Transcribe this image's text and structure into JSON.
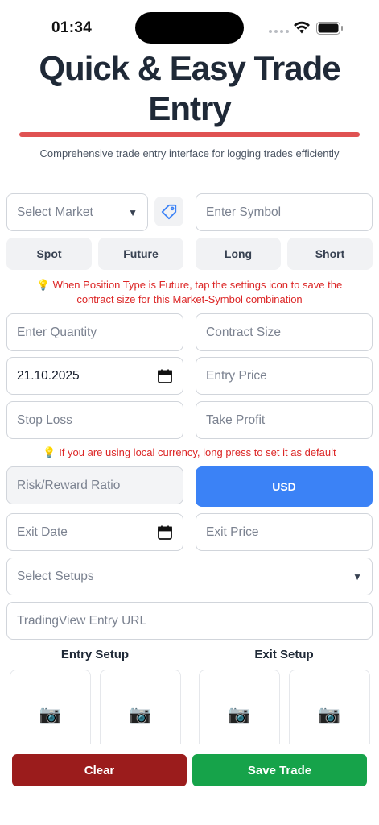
{
  "status_bar": {
    "time": "01:34"
  },
  "header": {
    "title": "Quick & Easy Trade Entry",
    "subtitle": "Comprehensive trade entry interface for logging trades efficiently",
    "accent_color": "#e05252"
  },
  "form": {
    "market_select": {
      "placeholder": "Select Market",
      "icon": "tag-icon"
    },
    "symbol": {
      "placeholder": "Enter Symbol"
    },
    "market_type": [
      "Spot",
      "Future"
    ],
    "position_type": [
      "Long",
      "Short"
    ],
    "hint_contract": "When Position Type is Future, tap the settings icon to save the contract size for this Market-Symbol combination",
    "quantity": {
      "placeholder": "Enter Quantity"
    },
    "contract_size": {
      "placeholder": "Contract Size"
    },
    "entry_date": {
      "value": "21.10.2025",
      "icon": "calendar-icon"
    },
    "entry_price": {
      "placeholder": "Entry Price"
    },
    "stop_loss": {
      "placeholder": "Stop Loss"
    },
    "take_profit": {
      "placeholder": "Take Profit"
    },
    "hint_currency": "If you are using local currency, long press to set it as default",
    "risk_reward": {
      "placeholder": "Risk/Reward Ratio"
    },
    "currency_button": {
      "label": "USD",
      "color": "#3b82f6"
    },
    "exit_date": {
      "placeholder": "Exit Date",
      "icon": "calendar-icon"
    },
    "exit_price": {
      "placeholder": "Exit Price"
    },
    "setups_select": {
      "placeholder": "Select Setups"
    },
    "tradingview_url": {
      "placeholder": "TradingView Entry URL"
    },
    "entry_setup_label": "Entry Setup",
    "exit_setup_label": "Exit Setup",
    "camera_glyph": "📷",
    "bulb_glyph": "💡"
  },
  "actions": {
    "clear_label": "Clear",
    "clear_color": "#9b1c1c",
    "save_label": "Save Trade",
    "save_color": "#16a34a"
  }
}
